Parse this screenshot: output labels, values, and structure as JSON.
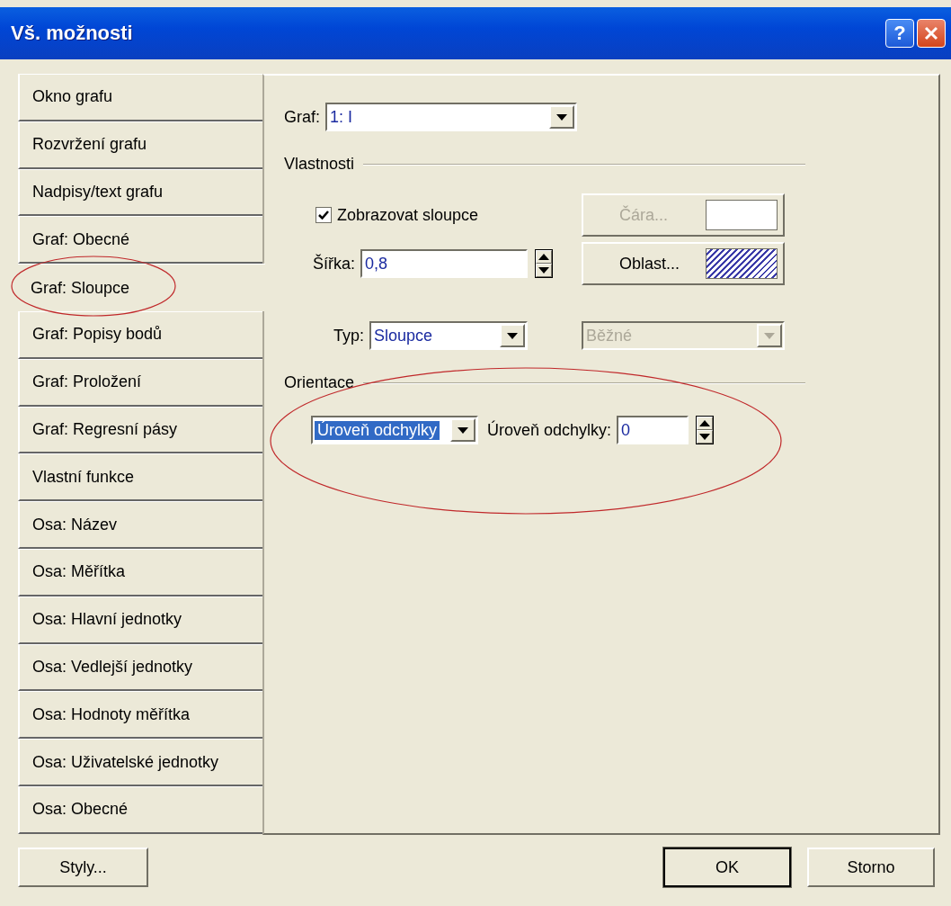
{
  "window": {
    "title": "Vš. možnosti",
    "help": "?"
  },
  "sidebar": {
    "items": [
      {
        "label": "Okno grafu",
        "selected": false
      },
      {
        "label": "Rozvržení grafu",
        "selected": false
      },
      {
        "label": "Nadpisy/text grafu",
        "selected": false
      },
      {
        "label": "Graf: Obecné",
        "selected": false
      },
      {
        "label": "Graf: Sloupce",
        "selected": true
      },
      {
        "label": "Graf: Popisy bodů",
        "selected": false
      },
      {
        "label": "Graf: Proložení",
        "selected": false
      },
      {
        "label": "Graf: Regresní pásy",
        "selected": false
      },
      {
        "label": "Vlastní funkce",
        "selected": false
      },
      {
        "label": "Osa: Název",
        "selected": false
      },
      {
        "label": "Osa: Měřítka",
        "selected": false
      },
      {
        "label": "Osa: Hlavní jednotky",
        "selected": false
      },
      {
        "label": "Osa: Vedlejší jednotky",
        "selected": false
      },
      {
        "label": "Osa: Hodnoty měřítka",
        "selected": false
      },
      {
        "label": "Osa: Uživatelské jednotky",
        "selected": false
      },
      {
        "label": "Osa: Obecné",
        "selected": false
      }
    ]
  },
  "panel": {
    "graph": {
      "label": "Graf:",
      "value": "1: I"
    },
    "properties": {
      "title": "Vlastnosti",
      "show_bars": {
        "label": "Zobrazovat sloupce",
        "checked": true
      },
      "line_button": {
        "label": "Čára...",
        "disabled": true
      },
      "width": {
        "label": "Šířka:",
        "value": "0,8"
      },
      "area_button": {
        "label": "Oblast...",
        "disabled": false
      },
      "type": {
        "label": "Typ:",
        "value": "Sloupce",
        "disabled": false
      },
      "subtype": {
        "value": "Běžné",
        "disabled": true
      }
    },
    "orientation": {
      "title": "Orientace",
      "mode": {
        "value": "Úroveň odchylky",
        "selected": true
      },
      "level": {
        "label": "Úroveň odchylky:",
        "value": "0"
      }
    }
  },
  "buttons": [
    {
      "label": "Styly...",
      "default": false
    },
    {
      "label": "OK",
      "default": true
    },
    {
      "label": "Storno",
      "default": false
    }
  ]
}
